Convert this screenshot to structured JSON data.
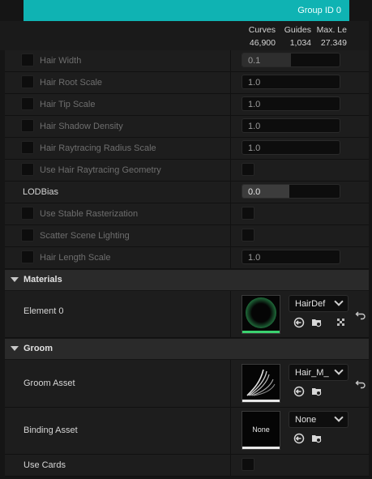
{
  "group": {
    "label": "Group ID 0"
  },
  "stats": {
    "curves_label": "Curves",
    "curves_value": "46,900",
    "guides_label": "Guides",
    "guides_value": "1,034",
    "maxlen_label": "Max. Le",
    "maxlen_value": "27.349"
  },
  "properties": [
    {
      "label": "Hair Width",
      "value": "0.1"
    },
    {
      "label": "Hair Root Scale",
      "value": "1.0"
    },
    {
      "label": "Hair Tip Scale",
      "value": "1.0"
    },
    {
      "label": "Hair Shadow Density",
      "value": "1.0"
    },
    {
      "label": "Hair Raytracing Radius Scale",
      "value": "1.0"
    },
    {
      "label": "Use Hair Raytracing Geometry"
    },
    {
      "label": "LODBias",
      "value": "0.0"
    },
    {
      "label": "Use Stable Rasterization"
    },
    {
      "label": "Scatter Scene Lighting"
    },
    {
      "label": "Hair Length Scale",
      "value": "1.0"
    }
  ],
  "materials": {
    "title": "Materials",
    "element_label": "Element 0",
    "asset": "HairDef"
  },
  "groom": {
    "title": "Groom",
    "groom_asset_label": "Groom Asset",
    "groom_asset_value": "Hair_M_",
    "binding_asset_label": "Binding Asset",
    "binding_asset_value": "None",
    "binding_thumb_text": "None",
    "use_cards_label": "Use Cards"
  },
  "icons": [
    "browse-arrow-icon",
    "find-in-browser-icon",
    "checker-icon",
    "reset-arrow-icon",
    "chevron-down-icon"
  ]
}
